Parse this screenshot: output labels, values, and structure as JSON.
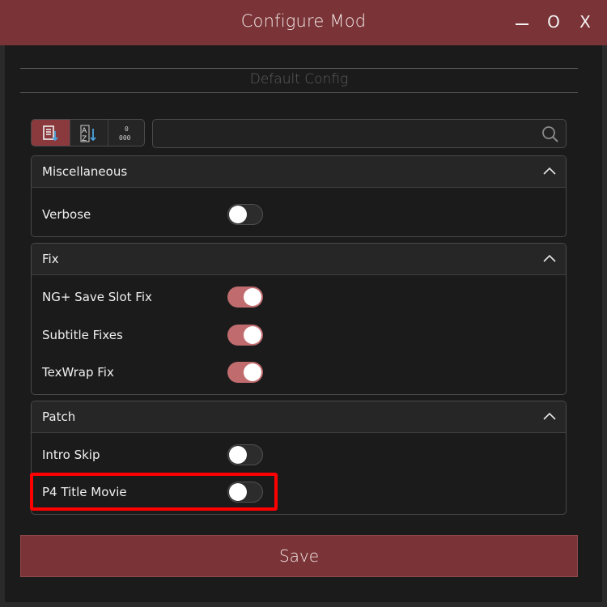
{
  "window": {
    "title": "Configure Mod",
    "controls": {
      "minimize": "",
      "maximize": "O",
      "close": "X"
    }
  },
  "config": {
    "title": "Default Config"
  },
  "toolbar": {
    "buttons": [
      {
        "icon": "sort-default-icon",
        "active": true
      },
      {
        "icon": "sort-alpha-icon",
        "active": false
      },
      {
        "icon": "binary-icon",
        "active": false
      }
    ]
  },
  "search": {
    "value": "",
    "placeholder": ""
  },
  "sections": [
    {
      "title": "Miscellaneous",
      "items": [
        {
          "label": "Verbose",
          "on": false
        }
      ]
    },
    {
      "title": "Fix",
      "items": [
        {
          "label": "NG+ Save Slot Fix",
          "on": true
        },
        {
          "label": "Subtitle Fixes",
          "on": true
        },
        {
          "label": "TexWrap Fix",
          "on": true
        }
      ]
    },
    {
      "title": "Patch",
      "items": [
        {
          "label": "Intro Skip",
          "on": false
        },
        {
          "label": "P4 Title Movie",
          "on": false
        }
      ]
    }
  ],
  "save": {
    "label": "Save"
  },
  "colors": {
    "accent": "#7a3336",
    "toggle_on": "#c06c6f",
    "highlight": "#ff0000"
  }
}
